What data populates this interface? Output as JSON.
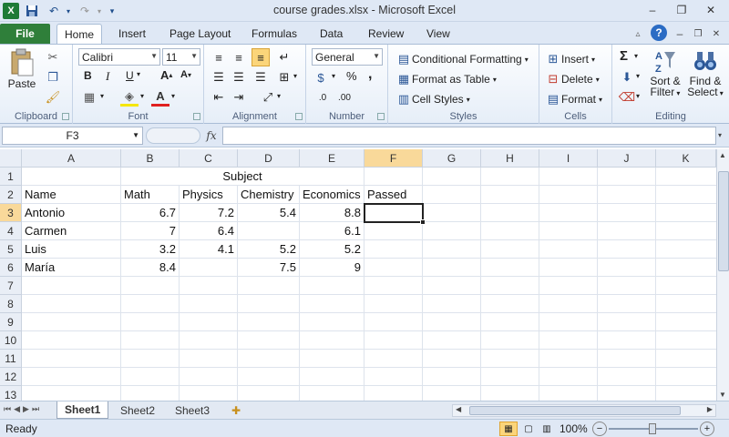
{
  "window": {
    "title": "course grades.xlsx - Microsoft Excel",
    "minimize": "–",
    "restore": "❐",
    "close": "✕"
  },
  "qat": {
    "save_icon": "floppy-disk-icon",
    "undo_icon": "undo-icon",
    "redo_icon": "redo-icon"
  },
  "tabs": [
    "File",
    "Home",
    "Insert",
    "Page Layout",
    "Formulas",
    "Data",
    "Review",
    "View"
  ],
  "active_tab": "Home",
  "ribbon": {
    "clipboard": {
      "label": "Clipboard",
      "paste": "Paste"
    },
    "font": {
      "label": "Font",
      "name": "Calibri",
      "size": "11",
      "bold": "B",
      "italic": "I",
      "underline": "U"
    },
    "alignment": {
      "label": "Alignment"
    },
    "number": {
      "label": "Number",
      "format": "General",
      "percent": "%",
      "comma": ","
    },
    "styles": {
      "label": "Styles",
      "conditional": "Conditional Formatting",
      "table": "Format as Table",
      "cell_styles": "Cell Styles"
    },
    "cells": {
      "label": "Cells",
      "insert": "Insert",
      "delete": "Delete",
      "format": "Format"
    },
    "editing": {
      "label": "Editing",
      "sum": "Σ",
      "sort": "Sort &",
      "filter": "Filter",
      "find": "Find &",
      "select": "Select"
    }
  },
  "formula_bar": {
    "name_box": "F3",
    "fx": "fx",
    "value": ""
  },
  "columns": [
    "A",
    "B",
    "C",
    "D",
    "E",
    "F",
    "G",
    "H",
    "I",
    "J",
    "K"
  ],
  "selected_col": "F",
  "rows": [
    "1",
    "2",
    "3",
    "4",
    "5",
    "6",
    "7",
    "8",
    "9",
    "10",
    "11",
    "12",
    "13"
  ],
  "selected_row": "3",
  "cells": {
    "r1": {
      "header": "Subject"
    },
    "r2": {
      "a": "Name",
      "b": "Math",
      "c": "Physics",
      "d": "Chemistry",
      "e": "Economics",
      "f": "Passed"
    },
    "r3": {
      "a": "Antonio",
      "b": "6.7",
      "c": "7.2",
      "d": "5.4",
      "e": "8.8"
    },
    "r4": {
      "a": "Carmen",
      "b": "7",
      "c": "6.4",
      "d": "",
      "e": "6.1"
    },
    "r5": {
      "a": "Luis",
      "b": "3.2",
      "c": "4.1",
      "d": "5.2",
      "e": "5.2"
    },
    "r6": {
      "a": "María",
      "b": "8.4",
      "c": "",
      "d": "7.5",
      "e": "9"
    }
  },
  "sheets": [
    "Sheet1",
    "Sheet2",
    "Sheet3"
  ],
  "active_sheet": "Sheet1",
  "status": {
    "ready": "Ready",
    "zoom": "100%",
    "minus": "−",
    "plus": "+"
  }
}
